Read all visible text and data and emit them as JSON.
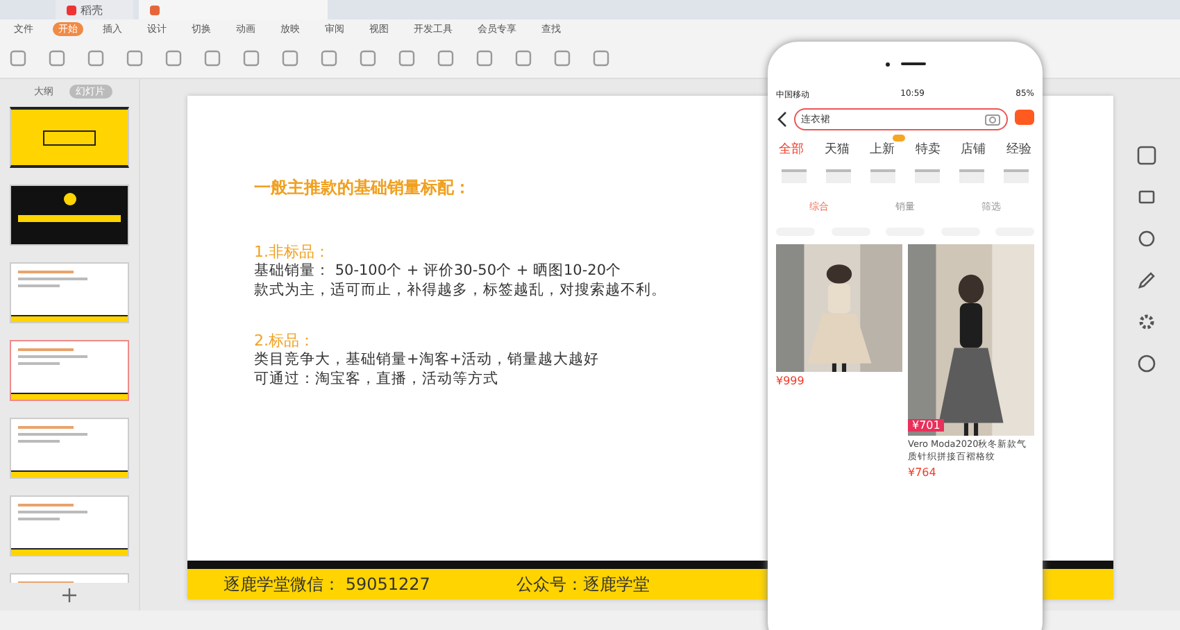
{
  "app_tabs": [
    {
      "label": "稻壳",
      "selected": false,
      "kind": "home"
    },
    {
      "selected": true,
      "kind": "doc"
    }
  ],
  "menu": [
    {
      "label": "文件",
      "selected": false
    },
    {
      "label": "开始",
      "selected": true
    },
    {
      "label": "插入",
      "selected": false
    },
    {
      "label": "设计",
      "selected": false
    },
    {
      "label": "切换",
      "selected": false
    },
    {
      "label": "动画",
      "selected": false
    },
    {
      "label": "放映",
      "selected": false
    },
    {
      "label": "审阅",
      "selected": false
    },
    {
      "label": "视图",
      "selected": false
    },
    {
      "label": "开发工具",
      "selected": false
    },
    {
      "label": "会员专享",
      "selected": false
    }
  ],
  "menu_search": "查找",
  "pane_tabs": [
    {
      "label": "大纲",
      "selected": false
    },
    {
      "label": "幻灯片",
      "selected": true
    }
  ],
  "thumbnails": [
    {
      "kind": "cover",
      "selected": false
    },
    {
      "kind": "dark",
      "selected": false
    },
    {
      "kind": "content",
      "selected": false
    },
    {
      "kind": "content",
      "selected": true
    },
    {
      "kind": "content",
      "selected": false
    },
    {
      "kind": "content",
      "selected": false
    },
    {
      "kind": "content",
      "selected": false
    }
  ],
  "slide": {
    "title": "一般主推款的基础销量标配：",
    "sections": [
      {
        "heading": "1.非标品：",
        "lines": [
          "基础销量：  50-100个 +  评价30-50个  +   晒图10-20个",
          "款式为主，适可而止，补得越多，标签越乱，对搜索越不利。"
        ]
      },
      {
        "heading": "2.标品：",
        "lines": [
          "类目竞争大，基础销量+淘客+活动，销量越大越好",
          "可通过：淘宝客，直播，活动等方式"
        ]
      }
    ],
    "footer": [
      "逐鹿学堂微信： 59051227",
      "公众号：逐鹿学堂"
    ]
  },
  "phone": {
    "carrier": "中国移动",
    "time": "10:59",
    "battery": "85%",
    "search": "连衣裙",
    "tabs": [
      {
        "label": "全部",
        "selected": true,
        "badge": false
      },
      {
        "label": "天猫",
        "selected": false,
        "badge": false
      },
      {
        "label": "上新",
        "selected": false,
        "badge": true
      },
      {
        "label": "特卖",
        "selected": false,
        "badge": false
      },
      {
        "label": "店铺",
        "selected": false,
        "badge": false
      },
      {
        "label": "经验",
        "selected": false,
        "badge": false
      }
    ],
    "sort": [
      {
        "label": "综合",
        "selected": true
      },
      {
        "label": "销量",
        "selected": false
      },
      {
        "label": "筛选",
        "selected": false
      }
    ],
    "products": [
      {
        "kind": "short",
        "price": "¥999"
      },
      {
        "kind": "tall",
        "title": "Vero Moda2020秋冬新款气质针织拼接百褶格纹",
        "price": "¥764",
        "image_price": "¥701"
      }
    ]
  }
}
